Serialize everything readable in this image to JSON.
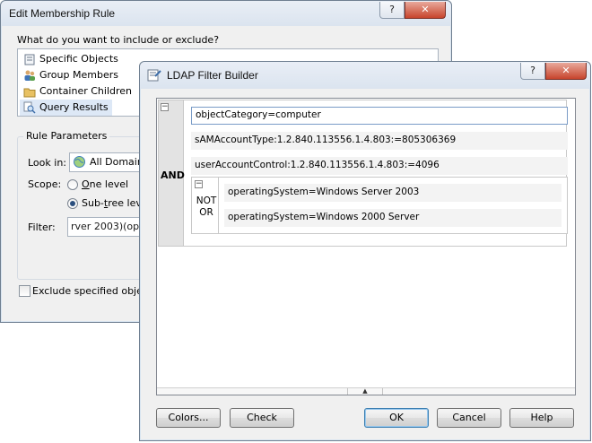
{
  "back_window": {
    "title": "Edit Membership Rule",
    "help_button": "?",
    "close_button": "✕",
    "include_prompt": "What do you want to include or exclude?",
    "include_items": [
      {
        "label": "Specific Objects",
        "icon": "object-icon"
      },
      {
        "label": "Group Members",
        "icon": "group-members-icon"
      },
      {
        "label": "Container Children",
        "icon": "container-icon"
      },
      {
        "label": "Query Results",
        "icon": "query-icon",
        "selected": true
      }
    ],
    "rule_parameters": {
      "title": "Rule Parameters",
      "look_in_label": "Look in:",
      "look_in_value": "All Domains",
      "scope_label": "Scope:",
      "scope_options": [
        {
          "label": "One level",
          "checked": false
        },
        {
          "label": "Sub-tree level",
          "checked": true
        }
      ],
      "filter_label": "Filter:",
      "filter_value": "rver 2003)(ope"
    },
    "exclude_label": "Exclude specified objects"
  },
  "front_window": {
    "title": "LDAP Filter Builder",
    "help_button": "?",
    "close_button": "✕",
    "and_group": {
      "operator": "AND",
      "collapse_glyph": "−",
      "conditions": [
        "objectCategory=computer",
        "sAMAccountType:1.2.840.113556.1.4.803:=805306369",
        "userAccountControl:1.2.840.113556.1.4.803:=4096"
      ],
      "not_or_group": {
        "operator_line1": "NOT",
        "operator_line2": "OR",
        "collapse_glyph": "−",
        "conditions": [
          "operatingSystem=Windows Server 2003",
          "operatingSystem=Windows 2000 Server"
        ]
      }
    },
    "scroll_glyph": "▲",
    "buttons": {
      "colors": "Colors...",
      "check": "Check",
      "ok": "OK",
      "cancel": "Cancel",
      "help": "Help"
    }
  }
}
